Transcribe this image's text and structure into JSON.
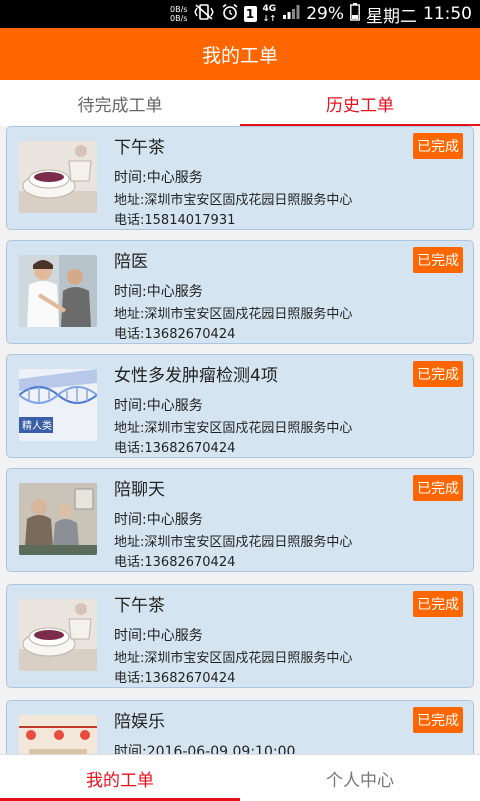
{
  "status_bar": {
    "speed_up": "0B/s",
    "speed_down": "0B/s",
    "sim": "1",
    "network": "4G",
    "battery": "29%",
    "weekday": "星期二",
    "time": "11:50"
  },
  "header": {
    "title": "我的工单"
  },
  "tabs": [
    {
      "label": "待完成工单",
      "active": false
    },
    {
      "label": "历史工单",
      "active": true
    }
  ],
  "orders": [
    {
      "title": "下午茶",
      "time": "时间:中心服务",
      "address": "地址:深圳市宝安区固戍花园日照服务中心",
      "phone": "电话:15814017931",
      "status": "已完成",
      "image": "tea-photo"
    },
    {
      "title": "陪医",
      "time": "时间:中心服务",
      "address": "地址:深圳市宝安区固戍花园日照服务中心",
      "phone": "电话:13682670424",
      "status": "已完成",
      "image": "doctor-photo"
    },
    {
      "title": "女性多发肿瘤检测4项",
      "time": "时间:中心服务",
      "address": "地址:深圳市宝安区固戍花园日照服务中心",
      "phone": "电话:13682670424",
      "status": "已完成",
      "image": "dna-photo",
      "image_text": "精人类"
    },
    {
      "title": "陪聊天",
      "time": "时间:中心服务",
      "address": "地址:深圳市宝安区固戍花园日照服务中心",
      "phone": "电话:13682670424",
      "status": "已完成",
      "image": "chat-photo"
    },
    {
      "title": "下午茶",
      "time": "时间:中心服务",
      "address": "地址:深圳市宝安区固戍花园日照服务中心",
      "phone": "电话:13682670424",
      "status": "已完成",
      "image": "tea-photo"
    },
    {
      "title": "陪娱乐",
      "time": "时间:2016-06-09 09:10:00",
      "address": "",
      "phone": "",
      "status": "已完成",
      "image": "party-photo"
    }
  ],
  "bottom_nav": [
    {
      "label": "我的工单",
      "active": true
    },
    {
      "label": "个人中心",
      "active": false
    }
  ],
  "colors": {
    "brand": "#ff6600",
    "accent_red": "#e8101b",
    "card_bg": "#d5e4f1"
  }
}
